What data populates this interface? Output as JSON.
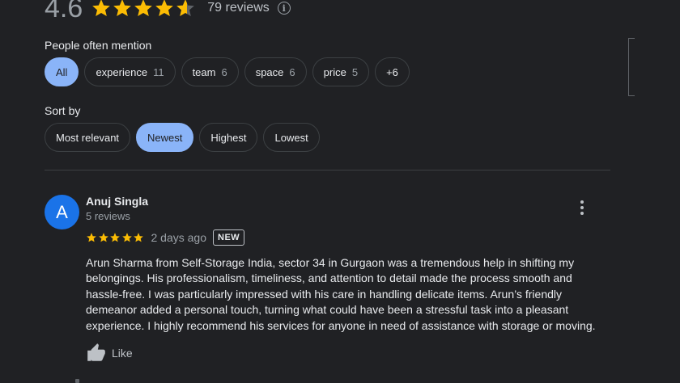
{
  "summary": {
    "rating": "4.6",
    "rating_value": 4.6,
    "reviews_label": "79 reviews",
    "star_color": "#fbbc04",
    "empty_star_color": "#5f6368"
  },
  "mentions": {
    "heading": "People often mention",
    "chips": [
      {
        "label": "All",
        "count": "",
        "selected": true
      },
      {
        "label": "experience",
        "count": "11"
      },
      {
        "label": "team",
        "count": "6"
      },
      {
        "label": "space",
        "count": "6"
      },
      {
        "label": "price",
        "count": "5"
      },
      {
        "label": "+6",
        "count": ""
      }
    ]
  },
  "sort": {
    "heading": "Sort by",
    "options": [
      {
        "label": "Most relevant"
      },
      {
        "label": "Newest",
        "selected": true
      },
      {
        "label": "Highest"
      },
      {
        "label": "Lowest"
      }
    ]
  },
  "review": {
    "avatar_letter": "A",
    "avatar_color": "#1a73e8",
    "name": "Anuj Singla",
    "sub": "5 reviews",
    "stars": 5,
    "time": "2 days ago",
    "badge": "NEW",
    "text": "Arun Sharma from Self-Storage India, sector 34 in Gurgaon was a tremendous help in shifting my belongings. His professionalism, timeliness, and attention to detail made the process smooth and hassle-free. I was particularly impressed with his care in handling delicate items. Arun’s friendly demeanor added a personal touch, turning what could have been a stressful task into a pleasant experience. I highly recommend his services for anyone in need of assistance with storage or moving.",
    "like_label": "Like"
  },
  "colors": {
    "background": "#202124",
    "accent": "#8ab4f8",
    "border": "#3c4043"
  }
}
